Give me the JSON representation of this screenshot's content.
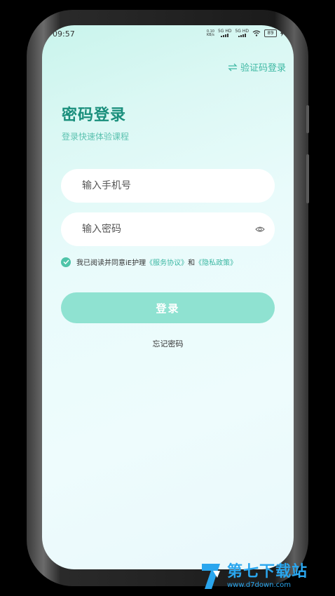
{
  "status_bar": {
    "time": "09:57",
    "net_speed_top": "0.10",
    "net_speed_bottom": "KB/s",
    "signal_1": "5G HD",
    "signal_2": "5G HD",
    "battery": "89"
  },
  "header": {
    "switch_login_label": "验证码登录"
  },
  "main": {
    "title": "密码登录",
    "subtitle": "登录快速体验课程",
    "phone_placeholder": "输入手机号",
    "password_placeholder": "输入密码",
    "agreement_prefix": "我已阅读并同意iE护理",
    "service_link": "《服务协议》",
    "agreement_and": "和",
    "privacy_link": "《隐私政策》",
    "login_label": "登录",
    "forgot_label": "忘记密码"
  },
  "watermark": {
    "site_name": "第七下载站",
    "site_url": "www.d7down.com"
  },
  "colors": {
    "accent": "#1a8f7c",
    "link": "#3cb7a3",
    "button": "#8fe2d1"
  }
}
